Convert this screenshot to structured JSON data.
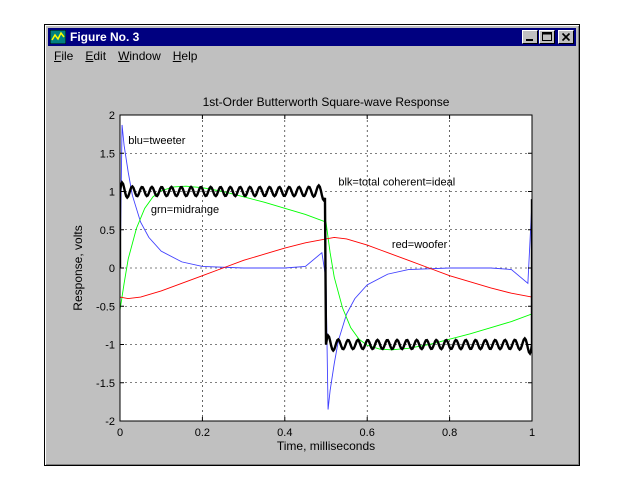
{
  "window": {
    "title": "Figure No. 3",
    "menu": [
      "File",
      "Edit",
      "Window",
      "Help"
    ],
    "controls": [
      "minimize-icon",
      "maximize-icon",
      "close-icon"
    ]
  },
  "chart_data": {
    "type": "line",
    "title": "1st-Order Butterworth Square-wave Response",
    "xlabel": "Time, milliseconds",
    "ylabel": "Response, volts",
    "xlim": [
      0,
      1
    ],
    "ylim": [
      -2,
      2
    ],
    "grid": true,
    "x_ticks": [
      "0",
      "0.2",
      "0.4",
      "0.6",
      "0.8",
      "1"
    ],
    "y_ticks": [
      "2",
      "1.5",
      "1",
      "0.5",
      "0",
      "-0.5",
      "-1",
      "-1.5",
      "-2"
    ],
    "annotations": [
      {
        "text": "blu=tweeter",
        "x": 0.02,
        "y": 1.62
      },
      {
        "text": "blk=total coherent=ideal",
        "x": 0.53,
        "y": 1.08
      },
      {
        "text": "grn=midrange",
        "x": 0.075,
        "y": 0.72
      },
      {
        "text": "red=woofer",
        "x": 0.66,
        "y": 0.26
      }
    ],
    "series": [
      {
        "name": "blu=tweeter",
        "color": "#4040ff",
        "x": [
          0,
          0.005,
          0.01,
          0.02,
          0.03,
          0.05,
          0.07,
          0.1,
          0.15,
          0.2,
          0.3,
          0.4,
          0.45,
          0.49,
          0.5,
          0.505,
          0.51,
          0.52,
          0.53,
          0.55,
          0.57,
          0.6,
          0.65,
          0.7,
          0.8,
          0.9,
          0.95,
          0.99,
          1.0
        ],
        "y": [
          -0.1,
          1.87,
          1.6,
          1.25,
          0.95,
          0.6,
          0.4,
          0.22,
          0.08,
          0.02,
          0.0,
          0.0,
          0.02,
          0.2,
          -0.15,
          -1.85,
          -1.6,
          -1.25,
          -0.95,
          -0.6,
          -0.4,
          -0.22,
          -0.08,
          -0.02,
          0.0,
          0.0,
          -0.02,
          -0.2,
          0.87
        ]
      },
      {
        "name": "grn=midrange",
        "color": "#00ff00",
        "x": [
          0,
          0.01,
          0.02,
          0.04,
          0.06,
          0.08,
          0.1,
          0.13,
          0.16,
          0.2,
          0.25,
          0.3,
          0.35,
          0.4,
          0.45,
          0.5,
          0.51,
          0.52,
          0.54,
          0.56,
          0.58,
          0.6,
          0.63,
          0.66,
          0.7,
          0.75,
          0.8,
          0.85,
          0.9,
          0.95,
          1.0
        ],
        "y": [
          -0.55,
          -0.2,
          0.12,
          0.52,
          0.78,
          0.93,
          1.01,
          1.06,
          1.07,
          1.05,
          1.0,
          0.93,
          0.86,
          0.78,
          0.7,
          0.6,
          0.2,
          -0.12,
          -0.52,
          -0.78,
          -0.93,
          -1.01,
          -1.06,
          -1.07,
          -1.05,
          -1.0,
          -0.93,
          -0.86,
          -0.78,
          -0.7,
          -0.6
        ]
      },
      {
        "name": "red=woofer",
        "color": "#ff0000",
        "x": [
          0,
          0.02,
          0.05,
          0.1,
          0.15,
          0.2,
          0.25,
          0.3,
          0.35,
          0.4,
          0.45,
          0.5,
          0.52,
          0.55,
          0.6,
          0.65,
          0.7,
          0.75,
          0.8,
          0.85,
          0.9,
          0.95,
          1.0
        ],
        "y": [
          -0.38,
          -0.4,
          -0.38,
          -0.3,
          -0.2,
          -0.1,
          0.0,
          0.1,
          0.18,
          0.26,
          0.33,
          0.38,
          0.4,
          0.38,
          0.3,
          0.2,
          0.1,
          0.0,
          -0.1,
          -0.18,
          -0.26,
          -0.33,
          -0.38
        ]
      },
      {
        "name": "blk=total coherent=ideal",
        "color": "#000000",
        "shape": "square-wave",
        "levels": [
          1,
          -1
        ],
        "period": 1,
        "ripple_amplitude": 0.06
      }
    ]
  }
}
